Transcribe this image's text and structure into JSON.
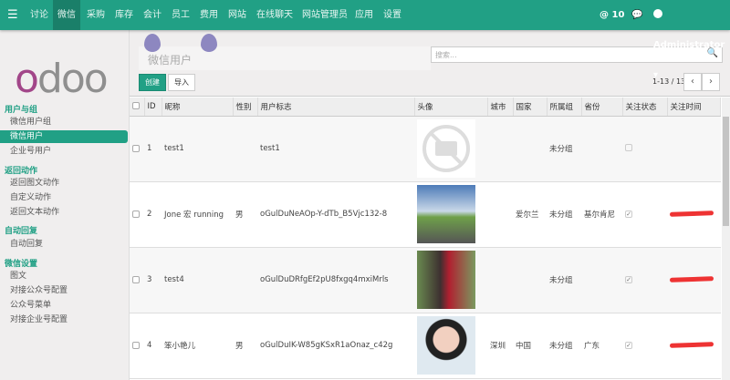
{
  "nav": {
    "menu_items": [
      "讨论",
      "微信",
      "采购",
      "库存",
      "会计",
      "员工",
      "费用",
      "网站",
      "在线聊天",
      "网站管理员",
      "应用",
      "设置"
    ],
    "active": "微信",
    "mentions": "10",
    "user": "Administrator"
  },
  "sidebar": {
    "sections": [
      {
        "title": "用户与组",
        "items": [
          "微信用户组",
          "微信用户",
          "企业号用户"
        ]
      },
      {
        "title": "返回动作",
        "items": [
          "返回图文动作",
          "自定义动作",
          "返回文本动作"
        ]
      },
      {
        "title": "自动回复",
        "items": [
          "自动回复"
        ]
      },
      {
        "title": "微信设置",
        "items": [
          "图文",
          "对接公众号配置",
          "公众号菜单",
          "对接企业号配置"
        ]
      }
    ],
    "active": "微信用户",
    "logo": "odoo"
  },
  "header": {
    "title": "微信用户",
    "search_placeholder": "搜索...",
    "create": "创建",
    "import": "导入",
    "pager": "1-13 / 13"
  },
  "table": {
    "columns": [
      "ID",
      "昵称",
      "性别",
      "用户标志",
      "头像",
      "城市",
      "国家",
      "所属组",
      "省份",
      "关注状态",
      "关注时间"
    ],
    "rows": [
      {
        "id": "1",
        "name": "test1",
        "sex": "",
        "openid": "test1",
        "city": "",
        "country": "",
        "group": "未分组",
        "province": "",
        "followed": false
      },
      {
        "id": "2",
        "name": "Jone 宏 running",
        "sex": "男",
        "openid": "oGulDuNeAOp-Y-dTb_B5Vjc132-8",
        "city": "",
        "country": "爱尔兰",
        "group": "未分组",
        "province": "基尔肯尼",
        "followed": true
      },
      {
        "id": "3",
        "name": "test4",
        "sex": "",
        "openid": "oGulDuDRfgEf2pU8fxgq4mxiMrls",
        "city": "",
        "country": "",
        "group": "未分组",
        "province": "",
        "followed": true
      },
      {
        "id": "4",
        "name": "笨小艳儿",
        "sex": "男",
        "openid": "oGulDuIK-W85gKSxR1aOnaz_c42g",
        "city": "深圳",
        "country": "中国",
        "group": "未分组",
        "province": "广东",
        "followed": true
      }
    ]
  },
  "colors": {
    "brand": "#21a085",
    "logo_purple": "#a24689"
  }
}
